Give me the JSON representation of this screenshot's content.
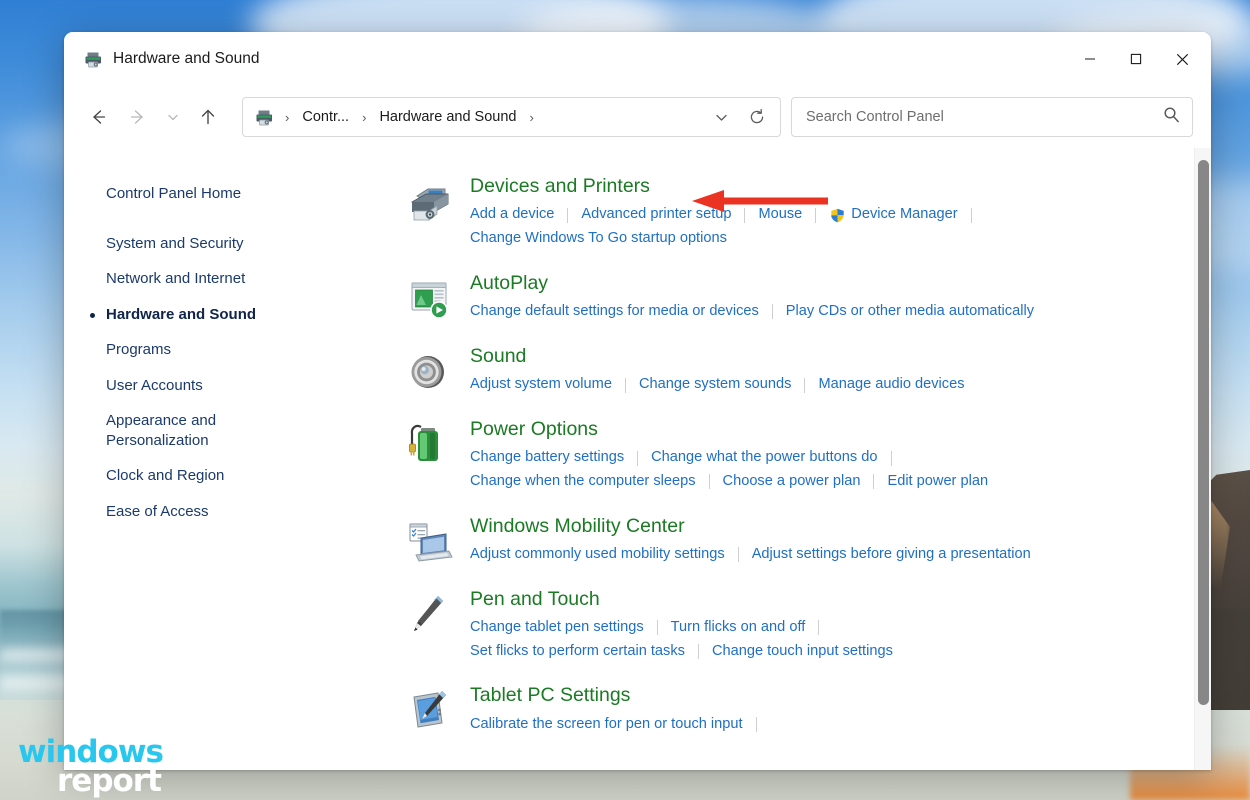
{
  "window": {
    "title": "Hardware and Sound",
    "title_icon": "printer-icon",
    "controls": {
      "minimize": "minimize-icon",
      "maximize": "maximize-icon",
      "close": "close-icon"
    }
  },
  "toolbar": {
    "back": "back-arrow-icon",
    "forward": "forward-arrow-icon",
    "recent": "chevron-down-icon",
    "up": "up-arrow-icon",
    "refresh": "refresh-icon",
    "address_dropdown": "chevron-down-icon",
    "breadcrumb_icon": "control-panel-icon",
    "breadcrumbs": [
      {
        "label": "Contr...",
        "sep": "›"
      },
      {
        "label": "Hardware and Sound",
        "sep": "›"
      }
    ]
  },
  "search": {
    "placeholder": "Search Control Panel",
    "value": "",
    "icon": "search-icon"
  },
  "sidebar": {
    "home": "Control Panel Home",
    "items": [
      {
        "label": "System and Security",
        "current": false
      },
      {
        "label": "Network and Internet",
        "current": false
      },
      {
        "label": "Hardware and Sound",
        "current": true
      },
      {
        "label": "Programs",
        "current": false
      },
      {
        "label": "User Accounts",
        "current": false
      },
      {
        "label": "Appearance and Personalization",
        "current": false
      },
      {
        "label": "Clock and Region",
        "current": false
      },
      {
        "label": "Ease of Access",
        "current": false
      }
    ]
  },
  "content": {
    "groups": [
      {
        "title": "Devices and Printers",
        "icon": "printer-device-icon",
        "rows": [
          [
            {
              "label": "Add a device"
            },
            {
              "label": "Advanced printer setup"
            },
            {
              "label": "Mouse"
            },
            {
              "label": "Device Manager",
              "shield": true
            }
          ],
          [
            {
              "label": "Change Windows To Go startup options"
            }
          ]
        ]
      },
      {
        "title": "AutoPlay",
        "icon": "autoplay-icon",
        "rows": [
          [
            {
              "label": "Change default settings for media or devices"
            },
            {
              "label": "Play CDs or other media automatically"
            }
          ]
        ]
      },
      {
        "title": "Sound",
        "icon": "speaker-icon",
        "rows": [
          [
            {
              "label": "Adjust system volume"
            },
            {
              "label": "Change system sounds"
            },
            {
              "label": "Manage audio devices"
            }
          ]
        ]
      },
      {
        "title": "Power Options",
        "icon": "battery-icon",
        "rows": [
          [
            {
              "label": "Change battery settings"
            },
            {
              "label": "Change what the power buttons do"
            },
            {
              "label": ""
            }
          ],
          [
            {
              "label": "Change when the computer sleeps"
            },
            {
              "label": "Choose a power plan"
            },
            {
              "label": "Edit power plan"
            }
          ]
        ]
      },
      {
        "title": "Windows Mobility Center",
        "icon": "laptop-icon",
        "rows": [
          [
            {
              "label": "Adjust commonly used mobility settings"
            },
            {
              "label": "Adjust settings before giving a presentation"
            }
          ]
        ]
      },
      {
        "title": "Pen and Touch",
        "icon": "pen-icon",
        "rows": [
          [
            {
              "label": "Change tablet pen settings"
            },
            {
              "label": "Turn flicks on and off"
            },
            {
              "label": ""
            }
          ],
          [
            {
              "label": "Set flicks to perform certain tasks"
            },
            {
              "label": "Change touch input settings"
            }
          ]
        ]
      },
      {
        "title": "Tablet PC Settings",
        "icon": "tablet-icon",
        "rows": [
          [
            {
              "label": "Calibrate the screen for pen or touch input"
            },
            {
              "label": ""
            }
          ]
        ]
      }
    ]
  },
  "annotation": {
    "arrow_color": "#ea3323",
    "points_to": "Devices and Printers"
  },
  "watermark": {
    "line1": "windows",
    "line2": "report",
    "color1": "#29c7ee",
    "color2": "#ffffff"
  },
  "colors": {
    "group_title_green": "#1b7a24",
    "link_blue": "#1f6fc4",
    "sidebar_navy": "#1b3a6b"
  }
}
